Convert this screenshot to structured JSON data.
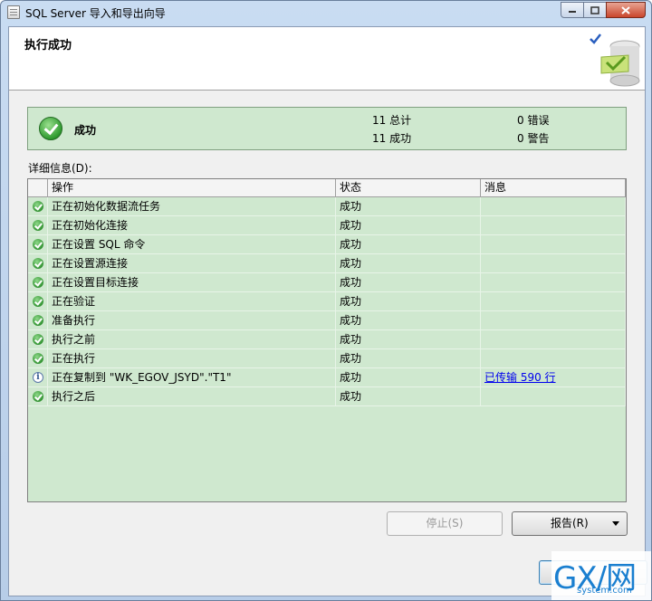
{
  "window": {
    "title": "SQL Server 导入和导出向导",
    "icon": "document-icon",
    "controls": {
      "minimize": "▭",
      "maximize": "□",
      "close": "✕"
    }
  },
  "header": {
    "title": "执行成功",
    "art_icon": "wizard-check-icon"
  },
  "summary": {
    "status": "成功",
    "total": "11 总计",
    "success": "11 成功",
    "errors": "0 错误",
    "warnings": "0 警告",
    "status_color": "#cfe8cf"
  },
  "details": {
    "label": "详细信息(D):",
    "columns": [
      "操作",
      "状态",
      "消息"
    ],
    "rows": [
      {
        "icon": "success-icon",
        "op": "正在初始化数据流任务",
        "status": "成功",
        "message": ""
      },
      {
        "icon": "success-icon",
        "op": "正在初始化连接",
        "status": "成功",
        "message": ""
      },
      {
        "icon": "success-icon",
        "op": "正在设置 SQL 命令",
        "status": "成功",
        "message": ""
      },
      {
        "icon": "success-icon",
        "op": "正在设置源连接",
        "status": "成功",
        "message": ""
      },
      {
        "icon": "success-icon",
        "op": "正在设置目标连接",
        "status": "成功",
        "message": ""
      },
      {
        "icon": "success-icon",
        "op": "正在验证",
        "status": "成功",
        "message": ""
      },
      {
        "icon": "success-icon",
        "op": "准备执行",
        "status": "成功",
        "message": ""
      },
      {
        "icon": "success-icon",
        "op": "执行之前",
        "status": "成功",
        "message": ""
      },
      {
        "icon": "success-icon",
        "op": "正在执行",
        "status": "成功",
        "message": ""
      },
      {
        "icon": "info-icon",
        "op": "正在复制到 \"WK_EGOV_JSYD\".\"T1\"",
        "status": "成功",
        "message": "已传输 590 行"
      },
      {
        "icon": "success-icon",
        "op": "执行之后",
        "status": "成功",
        "message": ""
      }
    ]
  },
  "buttons": {
    "stop": "停止(S)",
    "report": "报告(R)"
  },
  "watermark": {
    "text": "GX/网",
    "sub": "system.com"
  }
}
